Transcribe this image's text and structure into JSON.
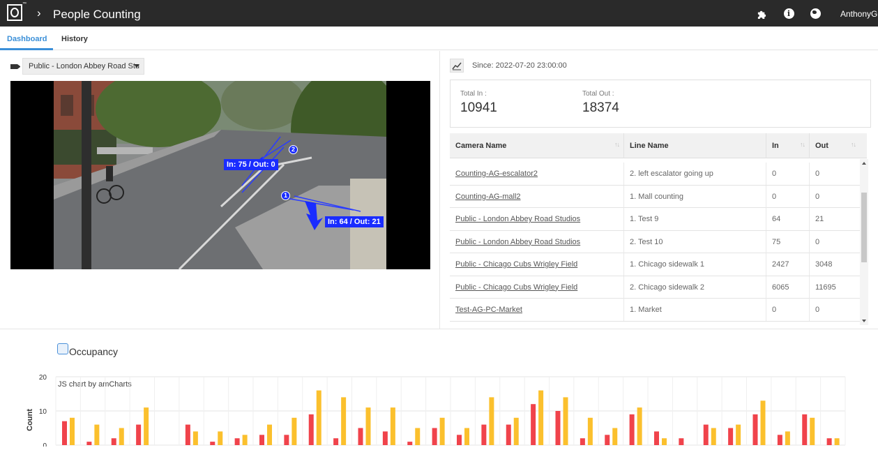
{
  "header": {
    "app_title": "People Counting",
    "username": "AnthonyG",
    "icons": [
      "puzzle-icon",
      "info-icon",
      "globe-icon"
    ]
  },
  "tabs": [
    {
      "label": "Dashboard",
      "active": true
    },
    {
      "label": "History",
      "active": false
    }
  ],
  "camera_select": {
    "value": "Public - London Abbey Road Stu"
  },
  "video": {
    "overlays": [
      {
        "badge": "2",
        "label": "In: 75 / Out: 0"
      },
      {
        "badge": "1",
        "label": "In: 64 / Out: 21"
      }
    ]
  },
  "stats": {
    "since": "Since: 2022-07-20 23:00:00",
    "total_in_label": "Total In :",
    "total_in": "10941",
    "total_out_label": "Total Out :",
    "total_out": "18374"
  },
  "table": {
    "columns": [
      "Camera Name",
      "Line Name",
      "In",
      "Out"
    ],
    "rows": [
      [
        "Counting-AG-escalator2",
        "2. left escalator going up",
        "0",
        "0"
      ],
      [
        "Counting-AG-mall2",
        "1. Mall counting",
        "0",
        "0"
      ],
      [
        "Public - London Abbey Road Studios",
        "1. Test 9",
        "64",
        "21"
      ],
      [
        "Public - London Abbey Road Studios",
        "2. Test 10",
        "75",
        "0"
      ],
      [
        "Public - Chicago Cubs Wrigley Field",
        "1. Chicago sidewalk 1",
        "2427",
        "3048"
      ],
      [
        "Public - Chicago Cubs Wrigley Field",
        "2. Chicago sidewalk 2",
        "6065",
        "11695"
      ],
      [
        "Test-AG-PC-Market",
        "1. Market",
        "0",
        "0"
      ]
    ]
  },
  "occupancy": {
    "legend_label": "Occupancy",
    "credit": "JS chart by amCharts"
  },
  "chart_data": {
    "type": "bar",
    "ylabel": "Count",
    "y_ticks": [
      "20",
      "10",
      "0"
    ],
    "ylim": [
      0,
      20
    ],
    "colors": {
      "series_a": "#f0434b",
      "series_b": "#fbc02d"
    },
    "series": [
      {
        "values": [
          7,
          1,
          2,
          6,
          0,
          6,
          1,
          2,
          3,
          3,
          9,
          2,
          5,
          4,
          1,
          5,
          3,
          6,
          6,
          12,
          10,
          2,
          3,
          9,
          4,
          2,
          6,
          5,
          9,
          3,
          9,
          2
        ]
      },
      {
        "values": [
          8,
          6,
          5,
          11,
          0,
          4,
          4,
          3,
          6,
          8,
          16,
          14,
          11,
          11,
          5,
          8,
          5,
          14,
          8,
          16,
          14,
          8,
          5,
          11,
          2,
          0,
          5,
          6,
          13,
          4,
          8,
          2
        ]
      }
    ]
  }
}
